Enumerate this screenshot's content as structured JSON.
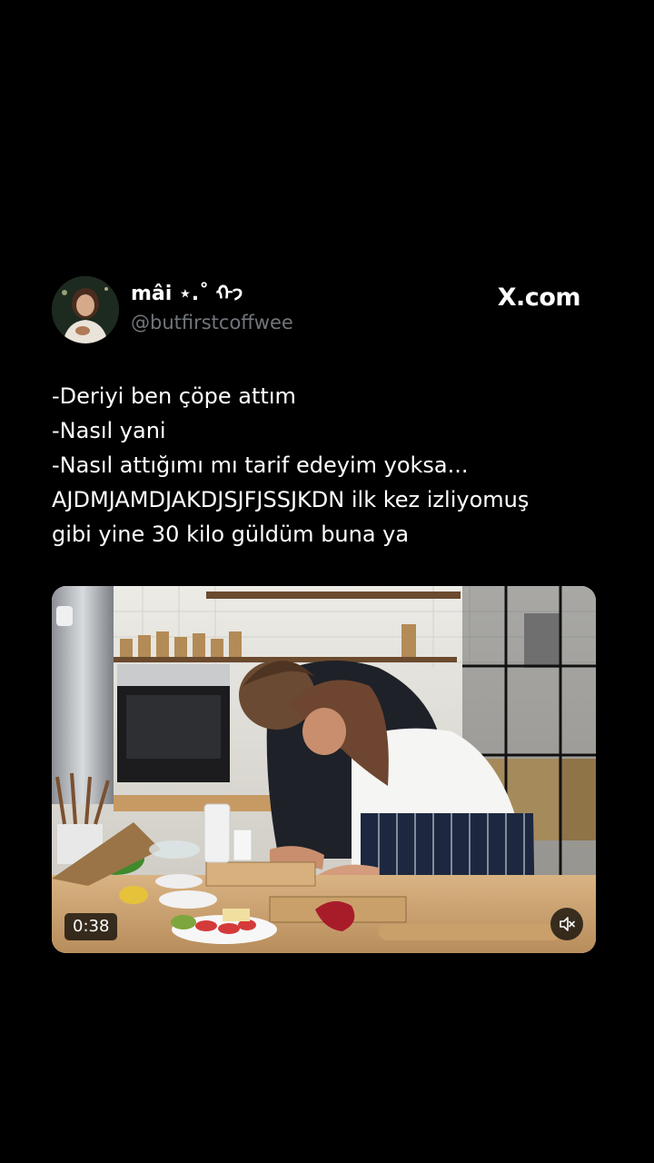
{
  "tweet": {
    "display_name": "mâi ⋆.˚ ᡣ𐭩",
    "handle": "@butfirstcoffwee",
    "brand": "X.com",
    "lines": [
      "-Deriyi ben çöpe attım",
      "-Nasıl yani",
      "-Nasıl attığımı mı tarif edeyim yoksa...",
      "AJDMJAMDJAKDJSJFJSSJKDN ilk kez izliyomuş",
      "gibi yine 30 kilo güldüm buna ya"
    ]
  },
  "video": {
    "duration": "0:38",
    "mute_icon": "speaker-muted-icon"
  },
  "colors": {
    "background": "#000000",
    "text": "#ffffff",
    "secondary_text": "#71767b"
  }
}
